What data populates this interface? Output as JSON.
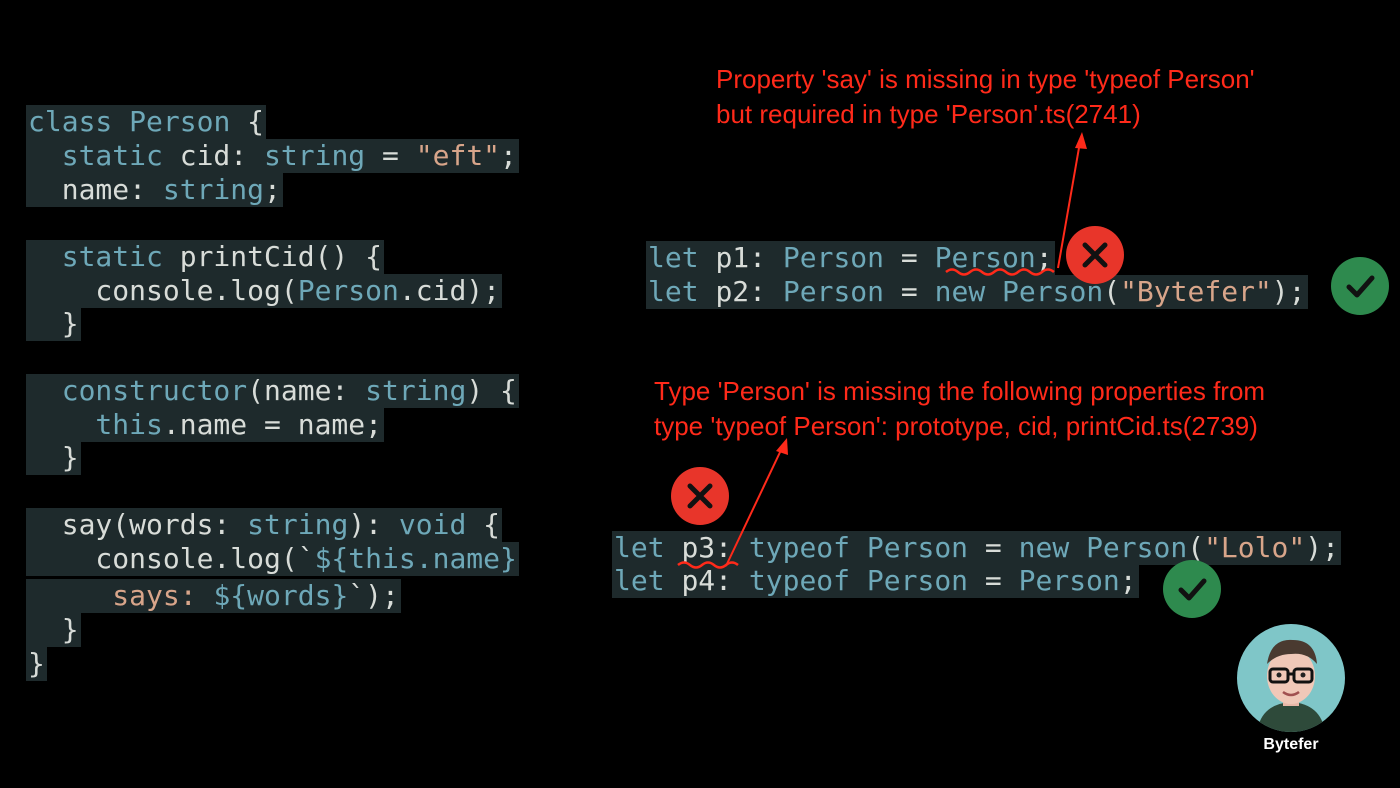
{
  "left_code": [
    [
      {
        "t": "class ",
        "c": "kw"
      },
      {
        "t": "Person ",
        "c": "type"
      },
      {
        "t": "{",
        "c": "plain"
      }
    ],
    [
      {
        "t": "  static ",
        "c": "kw"
      },
      {
        "t": "cid: ",
        "c": "plain"
      },
      {
        "t": "string",
        "c": "type"
      },
      {
        "t": " = ",
        "c": "plain"
      },
      {
        "t": "\"eft\"",
        "c": "str"
      },
      {
        "t": ";",
        "c": "plain"
      }
    ],
    [
      {
        "t": "  name: ",
        "c": "plain"
      },
      {
        "t": "string",
        "c": "type"
      },
      {
        "t": ";",
        "c": "plain"
      }
    ],
    [
      {
        "t": "  static ",
        "c": "kw"
      },
      {
        "t": "printCid() {",
        "c": "plain"
      }
    ],
    [
      {
        "t": "    console.log(",
        "c": "plain"
      },
      {
        "t": "Person",
        "c": "type"
      },
      {
        "t": ".cid);",
        "c": "plain"
      }
    ],
    [
      {
        "t": "  }",
        "c": "plain"
      }
    ],
    [
      {
        "t": "  constructor",
        "c": "kw"
      },
      {
        "t": "(name: ",
        "c": "plain"
      },
      {
        "t": "string",
        "c": "type"
      },
      {
        "t": ") {",
        "c": "plain"
      }
    ],
    [
      {
        "t": "    this",
        "c": "kw"
      },
      {
        "t": ".name = name;",
        "c": "plain"
      }
    ],
    [
      {
        "t": "  }",
        "c": "plain"
      }
    ],
    [
      {
        "t": "  say(words: ",
        "c": "plain"
      },
      {
        "t": "string",
        "c": "type"
      },
      {
        "t": "): ",
        "c": "plain"
      },
      {
        "t": "void",
        "c": "kw"
      },
      {
        "t": " {",
        "c": "plain"
      }
    ],
    [
      {
        "t": "    console.log(`",
        "c": "plain"
      },
      {
        "t": "${",
        "c": "type"
      },
      {
        "t": "this",
        "c": "kw"
      },
      {
        "t": ".name}",
        "c": "type"
      }
    ],
    [
      {
        "t": "     says: ",
        "c": "str"
      },
      {
        "t": "${words}",
        "c": "type"
      },
      {
        "t": "`);",
        "c": "plain"
      }
    ],
    [
      {
        "t": "  }",
        "c": "plain"
      }
    ],
    [
      {
        "t": "}",
        "c": "plain"
      }
    ]
  ],
  "right_code_top": [
    [
      {
        "t": "let ",
        "c": "kw"
      },
      {
        "t": "p1: ",
        "c": "plain"
      },
      {
        "t": "Person",
        "c": "type"
      },
      {
        "t": " = ",
        "c": "plain"
      },
      {
        "t": "Person",
        "c": "type"
      },
      {
        "t": ";",
        "c": "plain"
      }
    ],
    [
      {
        "t": "let ",
        "c": "kw"
      },
      {
        "t": "p2: ",
        "c": "plain"
      },
      {
        "t": "Person",
        "c": "type"
      },
      {
        "t": " = ",
        "c": "plain"
      },
      {
        "t": "new ",
        "c": "kw"
      },
      {
        "t": "Person",
        "c": "type"
      },
      {
        "t": "(",
        "c": "plain"
      },
      {
        "t": "\"Bytefer\"",
        "c": "str"
      },
      {
        "t": ");",
        "c": "plain"
      }
    ]
  ],
  "right_code_bottom": [
    [
      {
        "t": "let ",
        "c": "kw"
      },
      {
        "t": "p3: ",
        "c": "plain"
      },
      {
        "t": "typeof ",
        "c": "kw"
      },
      {
        "t": "Person",
        "c": "type"
      },
      {
        "t": " = ",
        "c": "plain"
      },
      {
        "t": "new ",
        "c": "kw"
      },
      {
        "t": "Person",
        "c": "type"
      },
      {
        "t": "(",
        "c": "plain"
      },
      {
        "t": "\"Lolo\"",
        "c": "str"
      },
      {
        "t": ");",
        "c": "plain"
      }
    ],
    [
      {
        "t": "let ",
        "c": "kw"
      },
      {
        "t": "p4: ",
        "c": "plain"
      },
      {
        "t": "typeof ",
        "c": "kw"
      },
      {
        "t": "Person",
        "c": "type"
      },
      {
        "t": " = ",
        "c": "plain"
      },
      {
        "t": "Person",
        "c": "type"
      },
      {
        "t": ";",
        "c": "plain"
      }
    ]
  ],
  "errors": {
    "top_line1": "Property 'say' is missing in type 'typeof Person'",
    "top_line2": "but required in type 'Person'.ts(2741)",
    "bottom_line1": "Type 'Person' is missing the following properties from",
    "bottom_line2": "type 'typeof Person': prototype, cid, printCid.ts(2739)"
  },
  "brand": "Bytefer",
  "colors": {
    "error": "#ff2a1a",
    "error_badge": "#e8352a",
    "ok_badge": "#2e8a4e"
  }
}
